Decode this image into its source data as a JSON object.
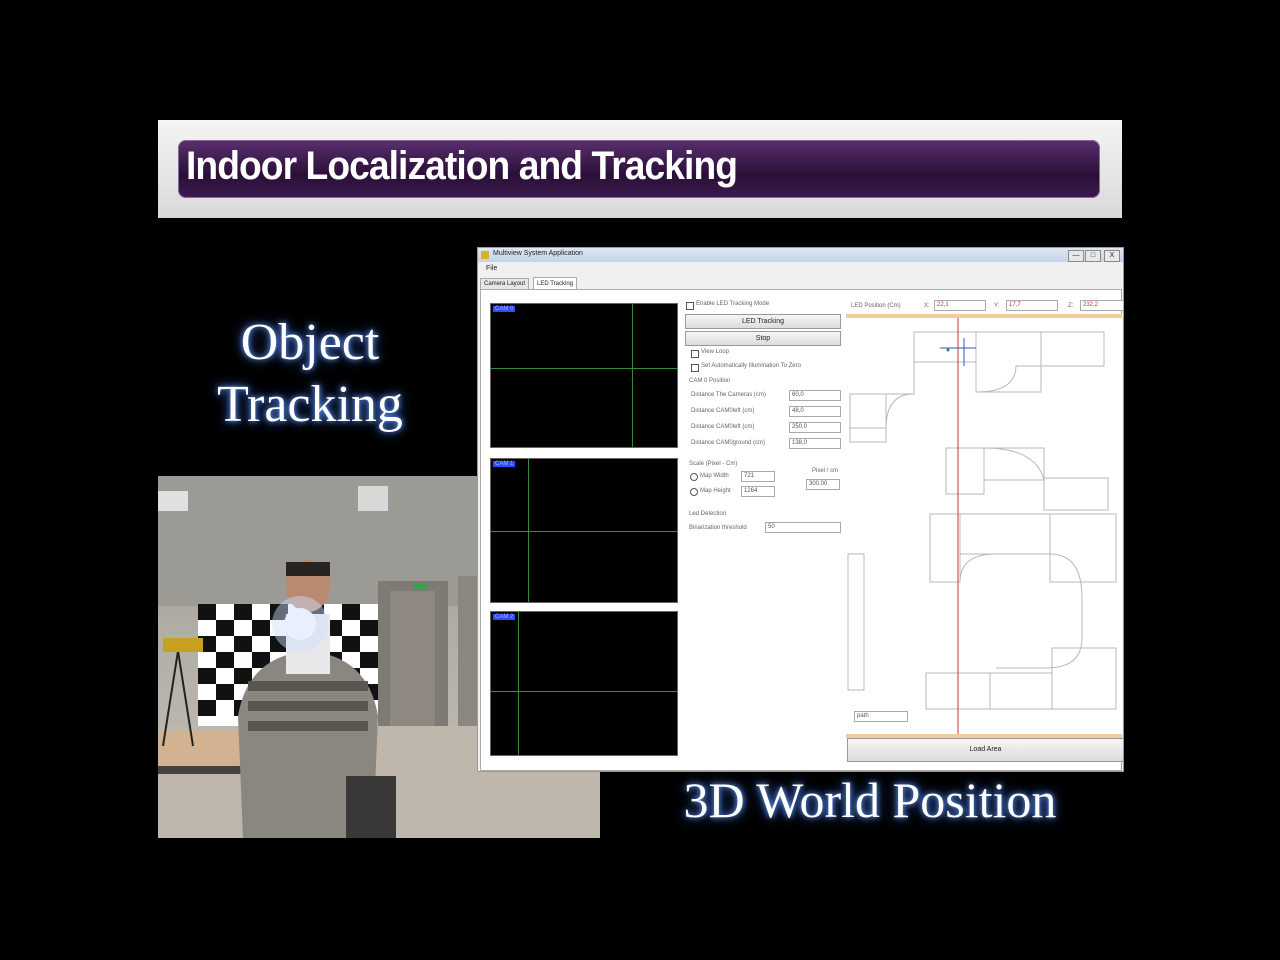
{
  "banner": {
    "title": "Indoor Localization and Tracking"
  },
  "captions": {
    "object_line1": "Object",
    "object_line2": "Tracking",
    "world": "3D World Position"
  },
  "window": {
    "title": "Multiview System Application",
    "menu": "File",
    "tabs": [
      "Camera Layout",
      "LED Tracking"
    ],
    "cams": [
      "CAM 0",
      "CAM 1",
      "CAM 2"
    ],
    "enable_led": "Enable LED Tracking Mode",
    "led_tracking_button": "LED Tracking",
    "stop_button": "Stop",
    "view_loop": "View Loop",
    "set_auto": "Set Automatically Illumination To Zero",
    "cam0_position": "CAM 0 Position",
    "distances": [
      {
        "label": "Distance The Cameras (cm)",
        "value": "60,0"
      },
      {
        "label": "Distance CAM0left (cm)",
        "value": "48,0"
      },
      {
        "label": "Distance CAM0left (cm)",
        "value": "250,0"
      },
      {
        "label": "Distance CAM0ground (cm)",
        "value": "138,0"
      }
    ],
    "scale_group": "Scale (Pixel - Cm)",
    "map_width_label": "Map Width",
    "map_width_value": "721",
    "map_height_label": "Map Height",
    "map_height_value": "1264",
    "pixel_cm_label": "Pixel / cm",
    "pixel_cm_value": "300,00",
    "led_detection": "Led Detection",
    "binarization_label": "Binarization threshold",
    "binarization_value": "50",
    "led_position_label": "LED Position (Cm)",
    "x_label": "X:",
    "x_value": "22,1",
    "y_label": "Y:",
    "y_value": "17,7",
    "z_label": "Z:",
    "z_value": "232,2",
    "path_field": "path",
    "load_area_button": "Load Area",
    "close_glyph": "X",
    "min_glyph": "—",
    "max_glyph": "□"
  },
  "colors": {
    "banner_purple": "#3a1a4c",
    "cam_line": "#3a8a3a",
    "red_marker": "#d03030"
  }
}
